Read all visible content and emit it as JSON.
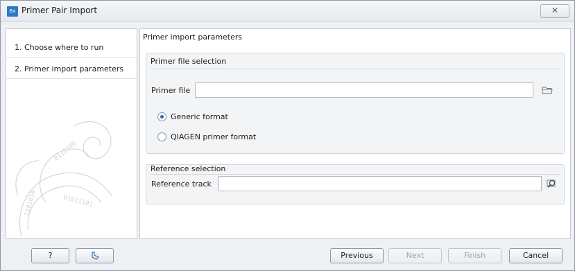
{
  "window": {
    "title": "Primer Pair Import",
    "app_icon_text": "Bx",
    "close_glyph": "✕"
  },
  "steps": [
    {
      "label": "1.  Choose where to run"
    },
    {
      "label": "2.  Primer import parameters"
    }
  ],
  "main": {
    "panel_title": "Primer import parameters",
    "primer_group": {
      "title": "Primer file selection",
      "field_label": "Primer file",
      "field_value": "",
      "browse_icon": "folder-icon",
      "options": [
        {
          "label": "Generic format",
          "checked": true
        },
        {
          "label": "QIAGEN primer format",
          "checked": false
        }
      ]
    },
    "reference_group": {
      "title": "Reference selection",
      "field_label": "Reference track",
      "field_value": "",
      "browse_icon": "search-icon"
    }
  },
  "footer": {
    "help_label": "?",
    "reset_icon": "undo-icon",
    "previous_label": "Previous",
    "next_label": "Next",
    "finish_label": "Finish",
    "cancel_label": "Cancel"
  },
  "colors": {
    "accent": "#2a63b6",
    "window_bg": "#eef0f3",
    "group_bg": "#f3f4f6"
  }
}
